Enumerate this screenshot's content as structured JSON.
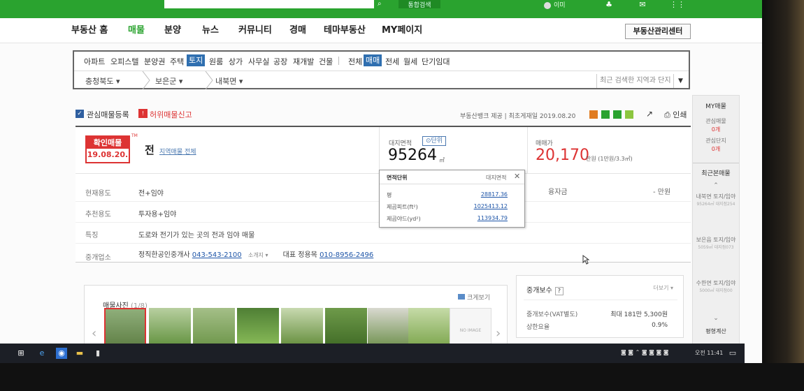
{
  "topbar": {
    "login_label": "통합검색",
    "user_label": "이미"
  },
  "nav": {
    "items": [
      "부동산 홈",
      "매물",
      "분양",
      "뉴스",
      "커뮤니티",
      "경매",
      "테마부동산",
      "MY페이지"
    ],
    "active": "매물",
    "manager_button": "부동산관리센터"
  },
  "filter": {
    "categories": [
      "아파트",
      "오피스텔",
      "분양권",
      "주택",
      "토지",
      "원룸",
      "상가",
      "사무실",
      "공장",
      "재개발",
      "건물"
    ],
    "selected_category": "토지",
    "deal_types": [
      "전체",
      "매매",
      "전세",
      "월세",
      "단기임대"
    ],
    "selected_deal": "매매",
    "regions": [
      "충청북도",
      "보은군",
      "내북면"
    ],
    "recent_placeholder": "최근 검색한 지역과 단지"
  },
  "sidebar": {
    "my_title": "MY매물",
    "interest_label": "관심매물",
    "interest_count": "0개",
    "complex_label": "관심단지",
    "complex_count": "0개",
    "recent_title": "최근본매물",
    "recent_items": [
      {
        "title": "내북면 토지/임야",
        "detail": "95264㎡ 대지점254"
      },
      {
        "title": "보은읍 토지/임야",
        "detail": "5059㎡ 대지점073"
      },
      {
        "title": "수한면 토지/임야",
        "detail": "5000㎡ 대지점00"
      }
    ],
    "calc_label": "평형계산"
  },
  "tools": {
    "favorite_label": "관심매물등록",
    "report_label": "허위매물신고",
    "meta": "부동산뱅크 제공 | 최초게재일 2019.08.20",
    "print_label": "인쇄"
  },
  "listing": {
    "stamp_label": "확인매물",
    "stamp_date": "19.08.20.",
    "tm": "TM",
    "type": "전",
    "map_link": "지역매물 전체",
    "area_label": "대지면적",
    "unit_button": "단위",
    "area_value": "95264",
    "area_unit": "㎡",
    "price_label": "매매가",
    "price_value": "20,170",
    "price_unit": "만원 (1만원/3.3㎡)",
    "loan_label": "융자금",
    "loan_value": "- 만원",
    "rows": [
      {
        "label": "현재용도",
        "value": "전+임야"
      },
      {
        "label": "추천용도",
        "value": "투자용+임야"
      },
      {
        "label": "특징",
        "value": "도로와 전기가 있는 곳의 전과 임야 매물"
      }
    ],
    "agent_label": "중개업소",
    "agent_name": "정직한공인중개사",
    "agent_phone": "043-543-2100",
    "agent_more": "소개지",
    "rep_label": "대표",
    "rep_name": "정용목",
    "rep_phone": "010-8956-2496"
  },
  "unit_popup": {
    "title": "면적단위",
    "right_label": "대지면적",
    "rows": [
      {
        "label": "평",
        "value": "28817.36"
      },
      {
        "label": "제곱피트(ft²)",
        "value": "1025413.12"
      },
      {
        "label": "제곱야드(yd²)",
        "value": "113934.79"
      }
    ]
  },
  "photos": {
    "title": "매물사진",
    "count": "(1/8)",
    "enlarge_label": "크게보기",
    "none_label": "NO IMAGE"
  },
  "fee": {
    "title": "중개보수",
    "more_label": "더보기",
    "rows": [
      {
        "label": "중개보수(VAT별도)",
        "value": "최대 181만 5,300원"
      },
      {
        "label": "상한요율",
        "value": "0.9%"
      }
    ]
  },
  "taskbar": {
    "time": "오전 11:41"
  },
  "colors": {
    "brand_green": "#2aa32f",
    "price_red": "#d33333",
    "link_blue": "#1e55a8"
  }
}
